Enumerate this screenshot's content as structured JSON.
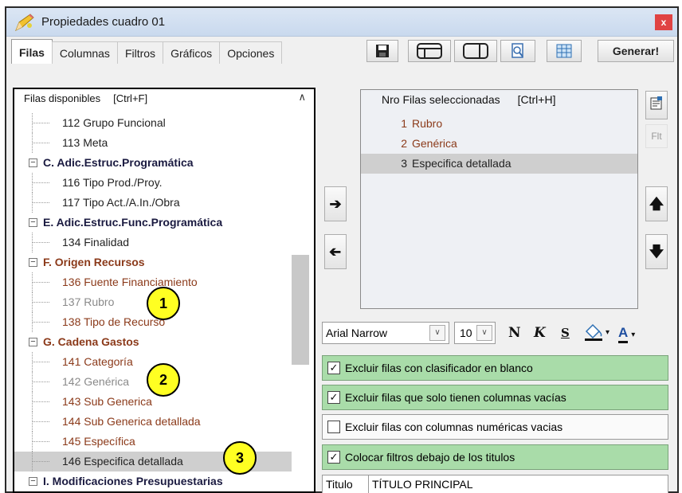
{
  "window": {
    "title": "Propiedades cuadro 01",
    "close_label": "x"
  },
  "tabs": [
    {
      "label": "Filas",
      "active": true
    },
    {
      "label": "Columnas"
    },
    {
      "label": "Filtros"
    },
    {
      "label": "Gráficos"
    },
    {
      "label": "Opciones"
    }
  ],
  "toolbar": {
    "generate_label": "Generar!"
  },
  "available": {
    "header": "Filas disponibles",
    "shortcut": "[Ctrl+F]",
    "rows": [
      {
        "text": "112 Grupo Funcional",
        "kind": "item",
        "color": "#222222"
      },
      {
        "text": "113 Meta",
        "kind": "item",
        "color": "#222222"
      },
      {
        "text": "C. Adic.Estruc.Programática",
        "kind": "category",
        "color": "#1a1a40"
      },
      {
        "text": "116 Tipo Prod./Proy.",
        "kind": "item",
        "color": "#222222"
      },
      {
        "text": "117 Tipo Act./A.In./Obra",
        "kind": "item",
        "color": "#222222"
      },
      {
        "text": "E. Adic.Estruc.Func.Programática",
        "kind": "category",
        "color": "#1a1a40"
      },
      {
        "text": "134 Finalidad",
        "kind": "item",
        "color": "#222222"
      },
      {
        "text": "F. Origen Recursos",
        "kind": "category",
        "color": "#8b3a1a"
      },
      {
        "text": "136 Fuente Financiamiento",
        "kind": "item",
        "color": "#8b3a1a"
      },
      {
        "text": "137 Rubro",
        "kind": "item",
        "color": "#8a8a8a"
      },
      {
        "text": "138 Tipo de Recurso",
        "kind": "item",
        "color": "#8b3a1a"
      },
      {
        "text": "G. Cadena Gastos",
        "kind": "category",
        "color": "#8b3a1a"
      },
      {
        "text": "141 Categoría",
        "kind": "item",
        "color": "#8b3a1a"
      },
      {
        "text": "142 Genérica",
        "kind": "item",
        "color": "#8a8a8a"
      },
      {
        "text": "143 Sub Generica",
        "kind": "item",
        "color": "#8b3a1a"
      },
      {
        "text": "144 Sub Generica detallada",
        "kind": "item",
        "color": "#8b3a1a"
      },
      {
        "text": "145 Específica",
        "kind": "item",
        "color": "#8b3a1a"
      },
      {
        "text": "146 Especifica detallada",
        "kind": "item",
        "color": "#222222",
        "selected": true
      },
      {
        "text": "I. Modificaciones Presupuestarias",
        "kind": "category",
        "color": "#1a1a40"
      }
    ]
  },
  "markers": [
    "1",
    "2",
    "3"
  ],
  "selected": {
    "num_header": "Nro",
    "header": "Filas seleccionadas",
    "shortcut": "[Ctrl+H]",
    "rows": [
      {
        "num": "1",
        "label": "Rubro",
        "color": "#8b3a1a"
      },
      {
        "num": "2",
        "label": "Genérica",
        "color": "#8b3a1a"
      },
      {
        "num": "3",
        "label": "Especifica detallada",
        "color": "#222222",
        "selected": true
      }
    ]
  },
  "side_buttons": {
    "flt_label": "Flt"
  },
  "format": {
    "font": "Arial Narrow",
    "size": "10",
    "bold_label": "N",
    "italic_label": "K",
    "strike_label": "S",
    "font_color_label": "A"
  },
  "options": [
    {
      "label": "Excluir filas con clasificador en blanco",
      "checked": true
    },
    {
      "label": "Excluir filas que solo tienen columnas vacías",
      "checked": true
    },
    {
      "label": "Excluir filas con columnas numéricas vacias",
      "checked": false
    },
    {
      "label": "Colocar filtros debajo de los titulos",
      "checked": true
    }
  ],
  "titulo": {
    "label": "Titulo",
    "value": "TÍTULO PRINCIPAL"
  }
}
